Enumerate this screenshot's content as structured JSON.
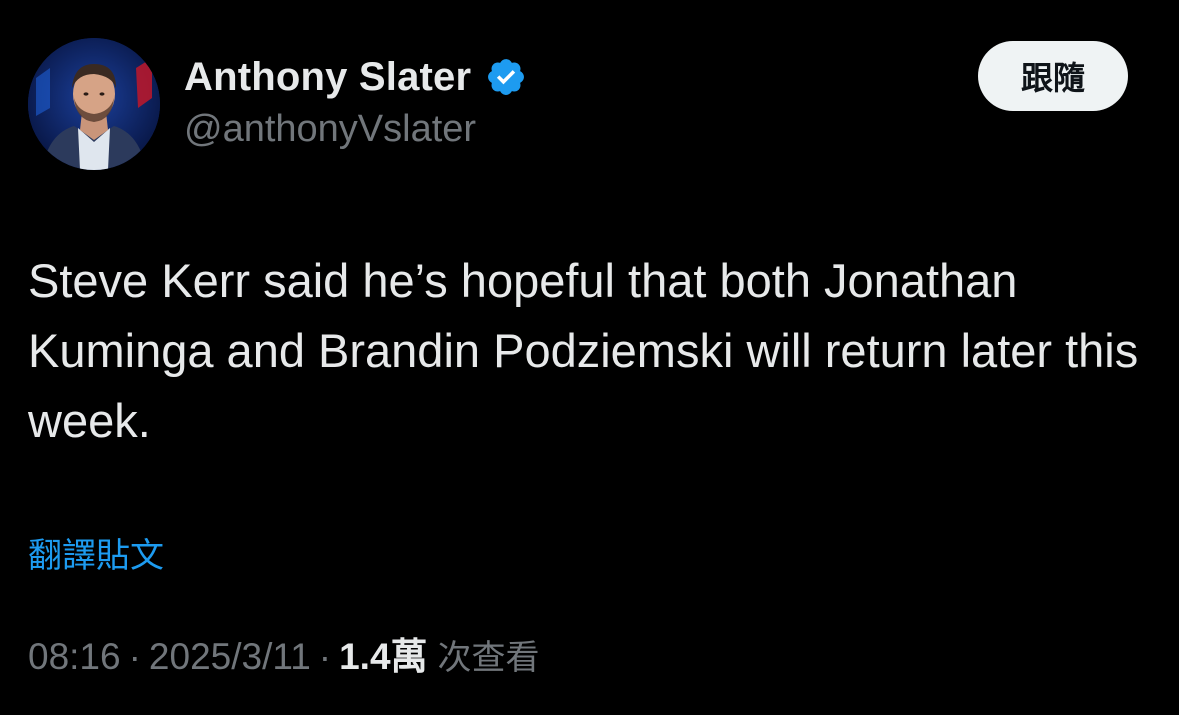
{
  "author": {
    "display_name": "Anthony Slater",
    "handle": "@anthonyVslater",
    "verified": true,
    "verified_color": "#1d9bf0",
    "avatar_icon": "profile-photo"
  },
  "follow_button": {
    "label": "跟隨"
  },
  "tweet": {
    "text": "Steve Kerr said he’s hopeful that both Jonathan Kuminga and Brandin Podziemski will return later this week.",
    "translate_label": "翻譯貼文"
  },
  "meta": {
    "time": "08:16",
    "separator": "·",
    "date": "2025/3/11",
    "views_count": "1.4萬",
    "views_label": "次查看"
  },
  "colors": {
    "background": "#000000",
    "primary_text": "#e7e9ea",
    "secondary_text": "#71767b",
    "link": "#1d9bf0",
    "button_bg": "#eff3f4",
    "button_text": "#0f1419"
  }
}
